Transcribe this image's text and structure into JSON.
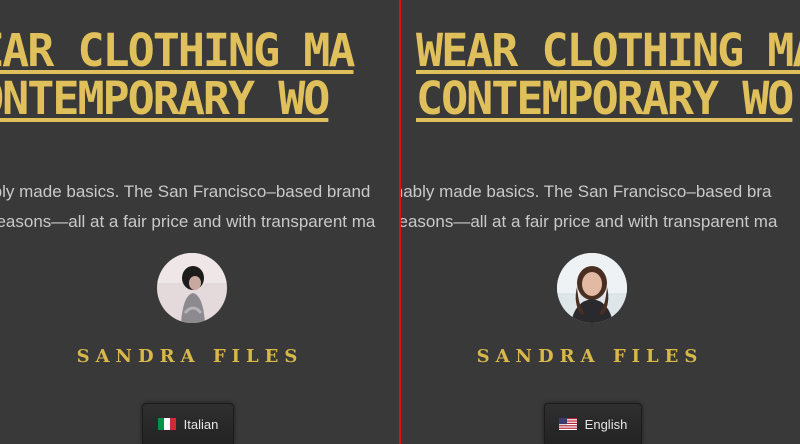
{
  "left_pane": {
    "headline_lines": [
      "WEAR CLOTHING MA",
      "CONTEMPORARY WO"
    ],
    "body_lines": [
      "inably made basics. The San Francisco–based brand",
      "le seasons—all at a fair price and with transparent ma"
    ],
    "name": "SANDRA FILES",
    "language_button": {
      "label": "Italian",
      "flag": "italy-flag-icon"
    }
  },
  "right_pane": {
    "headline_lines": [
      "WEAR CLOTHING MA",
      "CONTEMPORARY WO"
    ],
    "body_lines": [
      "inably made basics. The San Francisco–based bra",
      "seasons—all at a fair price and with transparent ma"
    ],
    "name": "SANDRA FILES",
    "language_button": {
      "label": "English",
      "flag": "us-flag-icon"
    }
  },
  "colors": {
    "background": "#3a3939",
    "accent_gold": "#e0c05a",
    "body_text": "#c9c9c9",
    "divider": "#e01010"
  }
}
